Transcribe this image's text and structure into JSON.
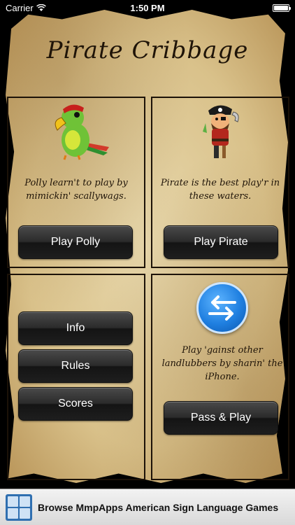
{
  "status": {
    "carrier": "Carrier",
    "time": "1:50 PM"
  },
  "title": "Pirate Cribbage",
  "panels": {
    "polly": {
      "caption": "Polly learn't to play by mimickin' scallywags.",
      "button": "Play Polly",
      "icon": "parrot-icon"
    },
    "pirate": {
      "caption": "Pirate is the best play'r in these waters.",
      "button": "Play Pirate",
      "icon": "pirate-icon"
    },
    "menu": {
      "buttons": [
        "Info",
        "Rules",
        "Scores"
      ]
    },
    "pass": {
      "caption": "Play 'gainst other landlubbers by sharin' the iPhone.",
      "button": "Pass & Play",
      "icon": "swap-arrows-icon"
    }
  },
  "ad": {
    "text": "Browse MmpApps American Sign Language Games",
    "icon": "sign-language-icon"
  },
  "colors": {
    "parchment": "#dcc48e",
    "ink": "#1f1408",
    "button": "#2b2b2b",
    "pass_icon": "#1f7fe0"
  }
}
